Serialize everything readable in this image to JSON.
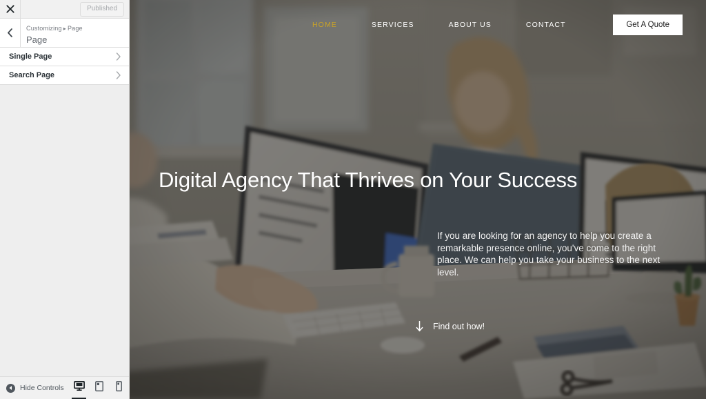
{
  "customizer": {
    "close_icon": "close-icon",
    "publish_button": "Published",
    "back_icon": "chevron-left-icon",
    "breadcrumb_prefix": "Customizing",
    "breadcrumb_separator": "▸",
    "breadcrumb_current": "Page",
    "panel_title": "Page",
    "sections": [
      {
        "label": "Single Page",
        "chevron": "chevron-right-icon"
      },
      {
        "label": "Search Page",
        "chevron": "chevron-right-icon"
      }
    ],
    "footer": {
      "hide_controls_label": "Hide Controls",
      "hide_controls_icon": "collapse-arrow-icon",
      "devices": [
        {
          "name": "desktop",
          "icon": "desktop-icon",
          "active": true
        },
        {
          "name": "tablet",
          "icon": "tablet-icon",
          "active": false
        },
        {
          "name": "mobile",
          "icon": "mobile-icon",
          "active": false
        }
      ]
    }
  },
  "preview": {
    "nav": {
      "links": [
        {
          "label": "HOME",
          "active": true
        },
        {
          "label": "SERVICES",
          "active": false
        },
        {
          "label": "ABOUT US",
          "active": false
        },
        {
          "label": "CONTACT",
          "active": false
        }
      ],
      "cta_button": "Get A Quote"
    },
    "hero": {
      "heading": "Digital Agency That Thrives on Your Success",
      "paragraph": "If you are looking for an agency to help you create a remarkable presence online, you've come to the right place. We can help you take your business to the next level.",
      "cta_label": "Find out how!",
      "cta_icon": "arrow-down-icon"
    }
  },
  "colors": {
    "accent_gold": "#c9a227",
    "sidebar_bg": "#eeeeee",
    "sidebar_panel": "#ffffff",
    "border": "#dddddd",
    "hero_overlay": "rgba(35,33,30,0.55)",
    "text_dark": "#2c3338",
    "text_muted": "#787c82"
  }
}
